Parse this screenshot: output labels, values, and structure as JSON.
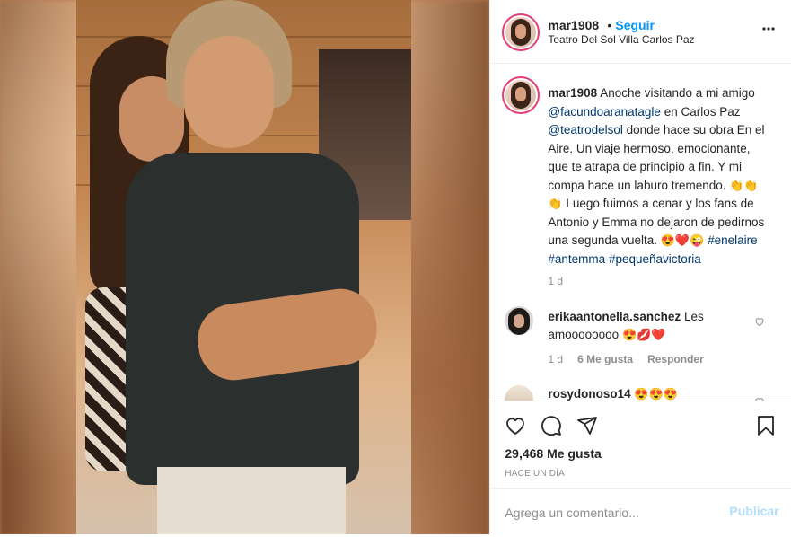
{
  "post": {
    "username": "mar1908",
    "separator": "•",
    "follow_label": "Seguir",
    "location": "Teatro Del Sol Villa Carlos Paz",
    "more_icon": "more-horizontal-icon"
  },
  "caption": {
    "username": "mar1908",
    "part1": " Anoche visitando a mi amigo ",
    "mention1": "@facundoaranatagle",
    "part2": " en Carlos Paz ",
    "mention2": "@teatrodelsol",
    "part3": " donde hace su obra En el Aire. Un viaje hermoso, emocionante, que te atrapa de principio a fin. Y mi compa hace un laburo tremendo. ",
    "emoji1": "👏👏👏",
    "part4": " Luego fuimos a cenar y los fans de Antonio y Emma no dejaron de pedirnos una segunda vuelta. ",
    "emoji2": "😍❤️😜",
    "space": " ",
    "hashtag1": "#enelaire",
    "hashtag2": "#antemma",
    "hashtag3": "#pequeñavictoria",
    "time": "1 d"
  },
  "comments": [
    {
      "username": "erikaantonella.sanchez",
      "text": " Les amoooooooo ",
      "emoji": "😍💋❤️",
      "time": "1 d",
      "likes": "6 Me gusta",
      "reply": "Responder"
    },
    {
      "username": "rosydonoso14",
      "emoji": "😍😍😍"
    }
  ],
  "actions": {
    "likes_text": "29,468 Me gusta",
    "when": "Hace un día",
    "comment_placeholder": "Agrega un comentario...",
    "post_label": "Publicar"
  },
  "colors": {
    "accent": "#0095f6",
    "link": "#00376b",
    "muted": "#8e8e8e",
    "post_disabled": "#b2dffc"
  }
}
